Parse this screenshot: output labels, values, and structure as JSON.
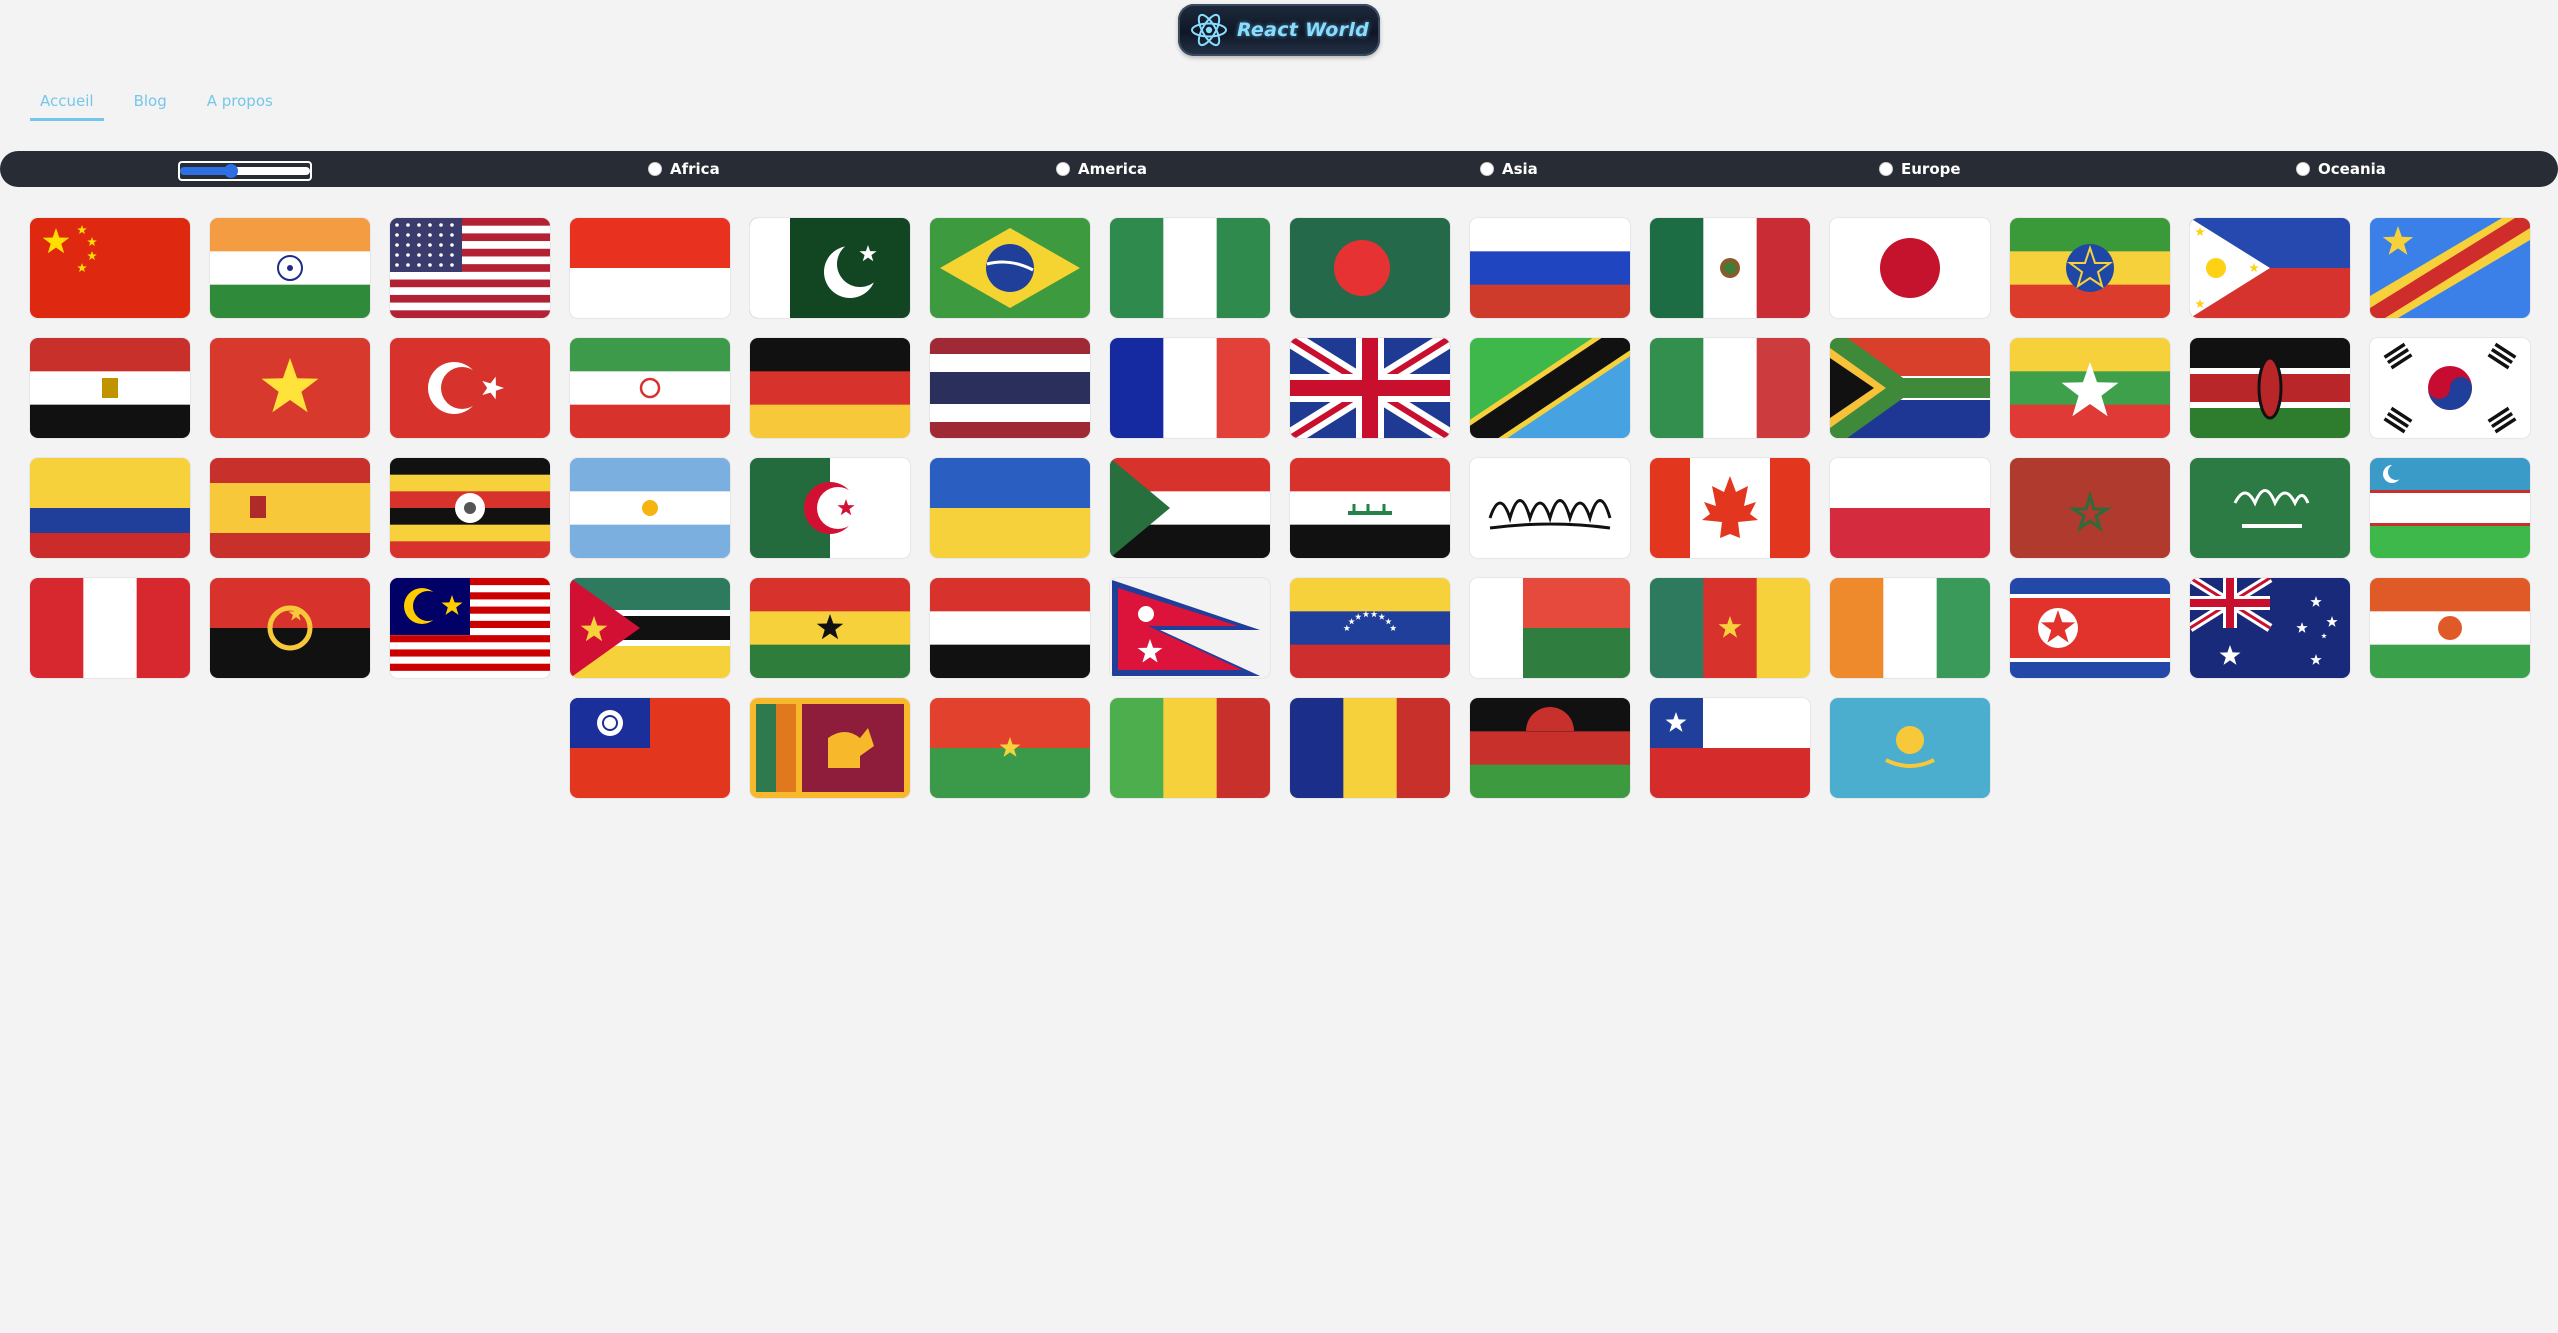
{
  "header": {
    "logo_text": "React World"
  },
  "nav": [
    {
      "label": "Accueil",
      "active": true
    },
    {
      "label": "Blog",
      "active": false
    },
    {
      "label": "A propos",
      "active": false
    }
  ],
  "filters": {
    "slider_value": 38,
    "regions": [
      "Africa",
      "America",
      "Asia",
      "Europe",
      "Oceania"
    ]
  },
  "flags": [
    "china",
    "india",
    "united-states",
    "indonesia",
    "pakistan",
    "brazil",
    "nigeria",
    "bangladesh",
    "russia",
    "mexico",
    "japan",
    "ethiopia",
    "philippines",
    "dr-congo",
    "egypt",
    "vietnam",
    "turkey",
    "iran",
    "germany",
    "thailand",
    "france",
    "united-kingdom",
    "tanzania",
    "italy",
    "south-africa",
    "myanmar",
    "kenya",
    "south-korea",
    "colombia",
    "spain",
    "uganda",
    "argentina",
    "algeria",
    "ukraine",
    "sudan",
    "iraq",
    "afghanistan",
    "canada",
    "poland",
    "morocco",
    "saudi-arabia",
    "uzbekistan",
    "peru",
    "angola",
    "malaysia",
    "mozambique",
    "ghana",
    "yemen",
    "nepal",
    "venezuela",
    "madagascar",
    "cameroon",
    "ivory-coast",
    "north-korea",
    "australia",
    "niger",
    "taiwan",
    "sri-lanka",
    "burkina-faso",
    "mali",
    "chad",
    "malawi",
    "chile",
    "kazakhstan"
  ]
}
